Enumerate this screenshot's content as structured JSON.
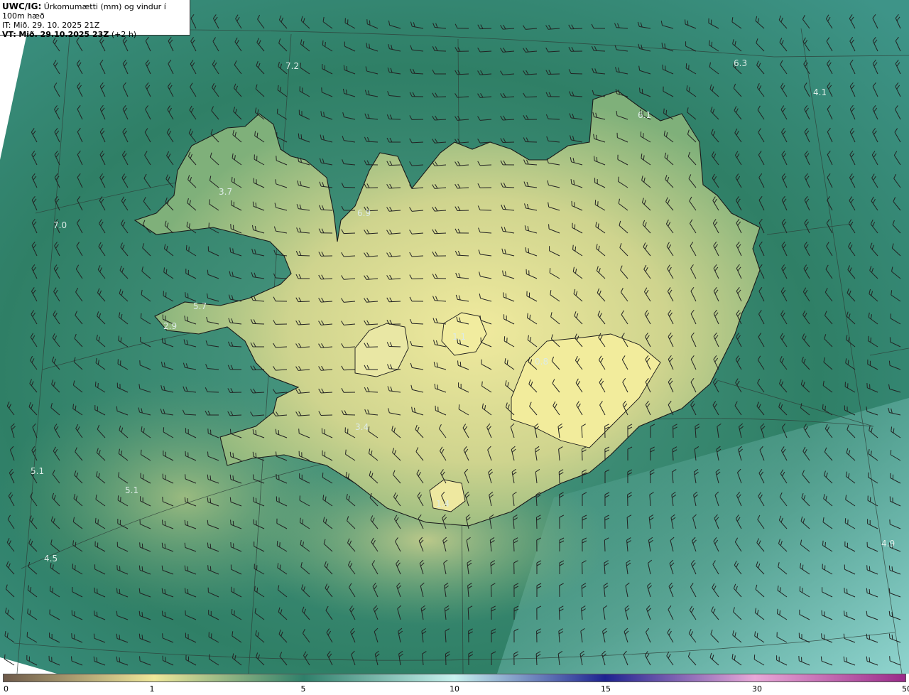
{
  "header": {
    "product": "UWC/IG:",
    "title": "Úrkomumætti (mm) og vindur í 100m hæð",
    "it_line": "IT: Mið. 29. 10. 2025 21Z",
    "vt_prefix": "VT:",
    "vt_time": "Mið. 29.10.2025 23Z",
    "vt_offset": "(+2 h)"
  },
  "map_labels": [
    {
      "text": "7.2"
    },
    {
      "text": "6.3"
    },
    {
      "text": "4.1"
    },
    {
      "text": "6.1"
    },
    {
      "text": "3.7"
    },
    {
      "text": "6.9"
    },
    {
      "text": "7.0"
    },
    {
      "text": "5.7"
    },
    {
      "text": "2.9"
    },
    {
      "text": "1.1"
    },
    {
      "text": "0.8"
    },
    {
      "text": "3.4"
    },
    {
      "text": "5.1"
    },
    {
      "text": "5.1"
    },
    {
      "text": "4.5"
    },
    {
      "text": "4.9"
    },
    {
      "text": "1.4"
    }
  ],
  "colorbar": {
    "ticks": [
      "0",
      "1",
      "5",
      "10",
      "15",
      "30",
      "50"
    ],
    "colors": {
      "c0": "#6e5a4a",
      "c1": "#efe89a",
      "c5": "#2f7f6a",
      "c10": "#c8f2ef",
      "c15": "#1e2390",
      "c30": "#e8a8d8",
      "c50": "#9a2a8a"
    }
  },
  "colors": {
    "sea_dark": "#2b7a5c",
    "sea_light": "#4f9e8e",
    "land_yellow": "#e4e39a",
    "land_green": "#8fbb7e",
    "coast": "#1a1a1a",
    "barb": "#222222"
  }
}
